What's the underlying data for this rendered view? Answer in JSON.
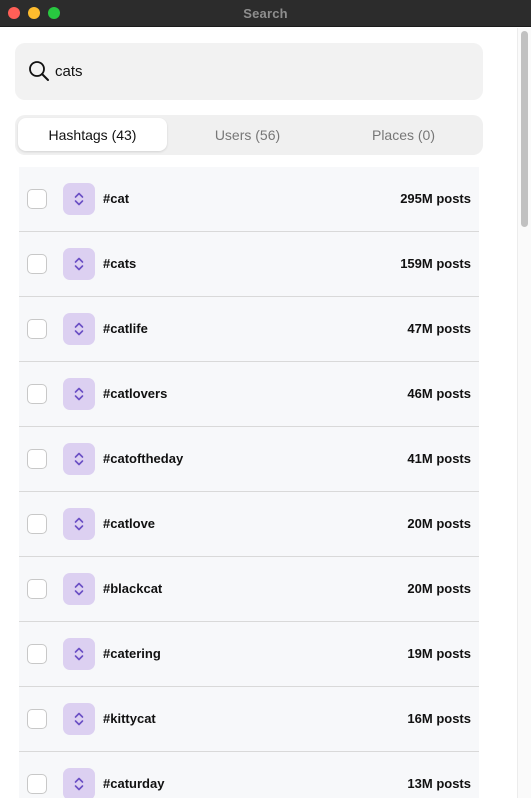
{
  "window": {
    "title": "Search"
  },
  "search": {
    "value": "cats"
  },
  "tabs": [
    {
      "label": "Hashtags (43)",
      "selected": true
    },
    {
      "label": "Users (56)",
      "selected": false
    },
    {
      "label": "Places (0)",
      "selected": false
    }
  ],
  "hashtags": [
    {
      "tag": "#cat",
      "posts": "295M posts"
    },
    {
      "tag": "#cats",
      "posts": "159M posts"
    },
    {
      "tag": "#catlife",
      "posts": "47M posts"
    },
    {
      "tag": "#catlovers",
      "posts": "46M posts"
    },
    {
      "tag": "#catoftheday",
      "posts": "41M posts"
    },
    {
      "tag": "#catlove",
      "posts": "20M posts"
    },
    {
      "tag": "#blackcat",
      "posts": "20M posts"
    },
    {
      "tag": "#catering",
      "posts": "19M posts"
    },
    {
      "tag": "#kittycat",
      "posts": "16M posts"
    },
    {
      "tag": "#caturday",
      "posts": "13M posts"
    }
  ],
  "colors": {
    "accent": "#6a4fc4",
    "handle_bg": "#dcd0f1",
    "row_bg": "#f7f8fa",
    "titlebar": "#2c2c2c"
  },
  "icons": {
    "search": "search-icon",
    "drag": "chevron-up-down-icon",
    "checkbox": "checkbox-icon"
  }
}
